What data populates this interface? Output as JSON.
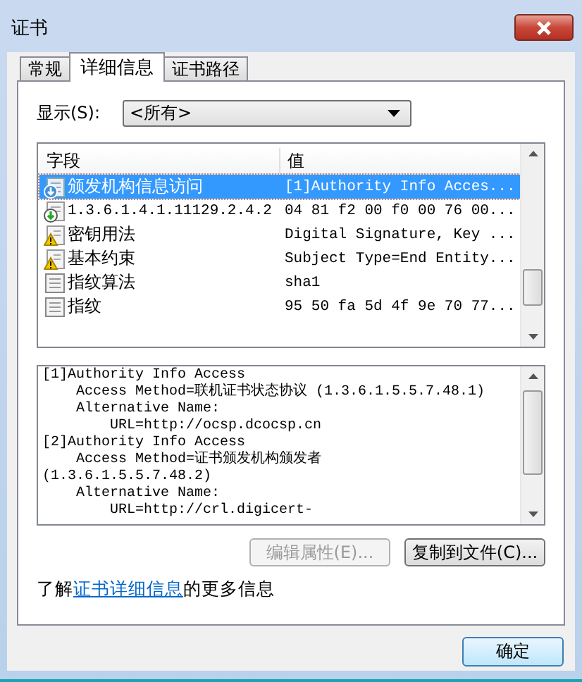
{
  "window": {
    "title": "证书"
  },
  "tabs": [
    {
      "label": "常规",
      "selected": false
    },
    {
      "label": "详细信息",
      "selected": true
    },
    {
      "label": "证书路径",
      "selected": false
    }
  ],
  "show": {
    "label": "显示(S):",
    "value": "<所有>"
  },
  "table": {
    "columns": [
      "字段",
      "值"
    ],
    "rows": [
      {
        "kind": "info-download",
        "field": "颁发机构信息访问",
        "value": "[1]Authority Info Acces...",
        "selected": true
      },
      {
        "kind": "download",
        "field": "1.3.6.1.4.1.11129.2.4.2",
        "value": "04 81 f2 00 f0 00 76 00...",
        "selected": false
      },
      {
        "kind": "warning",
        "field": "密钥用法",
        "value": "Digital Signature, Key ...",
        "selected": false
      },
      {
        "kind": "warning",
        "field": "基本约束",
        "value": "Subject Type=End Entity...",
        "selected": false
      },
      {
        "kind": "plain",
        "field": "指纹算法",
        "value": "sha1",
        "selected": false
      },
      {
        "kind": "plain",
        "field": "指纹",
        "value": "95 50 fa 5d 4f 9e 70 77...",
        "selected": false
      }
    ]
  },
  "detail": [
    {
      "kind": "entry",
      "text": "[1]Authority Info Access"
    },
    {
      "kind": "field",
      "text": "Access Method=联机证书状态协议 (1.3.6.1.5.5.7.48.1)"
    },
    {
      "kind": "field",
      "text": "Alternative Name:"
    },
    {
      "kind": "value",
      "text": "URL=http://ocsp.dcocsp.cn"
    },
    {
      "kind": "entry",
      "text": "[2]Authority Info Access"
    },
    {
      "kind": "field",
      "text": "Access Method=证书颁发机构颁发者"
    },
    {
      "kind": "entry",
      "text": "(1.3.6.1.5.5.7.48.2)"
    },
    {
      "kind": "field",
      "text": "Alternative Name:"
    },
    {
      "kind": "value",
      "text": "URL=http://crl.digicert-"
    }
  ],
  "buttons": [
    {
      "label": "编辑属性(E)...",
      "disabled": true
    },
    {
      "label": "复制到文件(C)...",
      "disabled": false
    }
  ],
  "info": {
    "before": "了解",
    "link": "证书详细信息",
    "after": "的更多信息"
  },
  "ok": "确定"
}
